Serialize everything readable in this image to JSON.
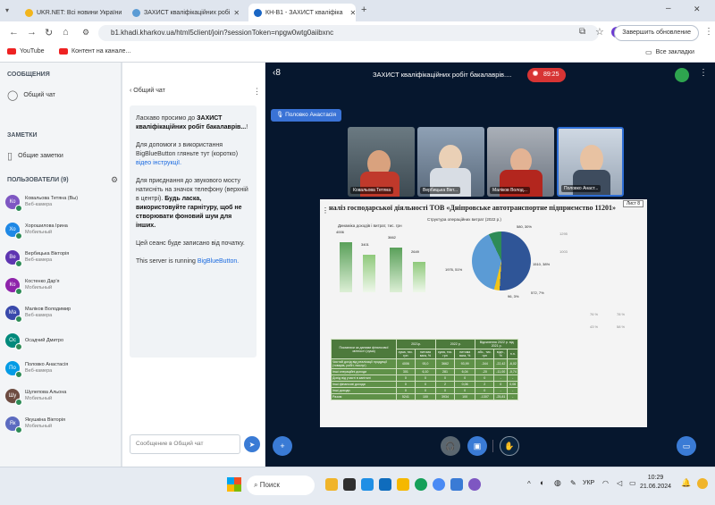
{
  "browser": {
    "tabs": [
      {
        "label": "UKR.NET: Всі новини України",
        "active": false
      },
      {
        "label": "ЗАХИСТ кваліфікаційних робі",
        "active": false
      },
      {
        "label": "КН-В1 - ЗАХИСТ кваліфіка",
        "active": true
      }
    ],
    "new_tab": "+",
    "window_min": "–",
    "window_close": "✕",
    "url": "b1.khadi.kharkov.ua/html5client/join?sessionToken=npgw0wtg0aiibxnc",
    "update_button": "Завершить обновление",
    "bookmarks": [
      {
        "label": "YouTube"
      },
      {
        "label": "Контент на канале..."
      }
    ],
    "all_bookmarks": "Все закладки"
  },
  "sidebar": {
    "messages_heading": "СООБЩЕНИЯ",
    "public_chat": "Общий чат",
    "notes_heading": "ЗАМЕТКИ",
    "shared_notes": "Общие заметки",
    "users_heading": "ПОЛЬЗОВАТЕЛИ (9)",
    "users": [
      {
        "initials": "Ко",
        "name": "Ковальова Тетяна (Вы)",
        "sub": "Веб-камера",
        "color": "#7e57c2"
      },
      {
        "initials": "Хо",
        "name": "Хорошилова Ірина",
        "sub": "Мобильный",
        "color": "#1e88e5"
      },
      {
        "initials": "Ве",
        "name": "Вербицька Вікторія",
        "sub": "Веб-камера",
        "color": "#5e35b1"
      },
      {
        "initials": "Ко",
        "name": "Костенко Дар'я",
        "sub": "Мобильный",
        "color": "#8e24aa"
      },
      {
        "initials": "Ма",
        "name": "Маліков Володимир",
        "sub": "Веб-камера",
        "color": "#3949ab"
      },
      {
        "initials": "Ос",
        "name": "Осадчий Дмитро",
        "sub": "",
        "color": "#00897b"
      },
      {
        "initials": "По",
        "name": "Половко Анастасія",
        "sub": "Веб-камера",
        "color": "#039be5"
      },
      {
        "initials": "Шу",
        "name": "Шулепова Альона",
        "sub": "Мобильный",
        "color": "#6d4c41"
      },
      {
        "initials": "Як",
        "name": "Якушкіна Вікторія",
        "sub": "Мобильный",
        "color": "#5c6bc0"
      }
    ]
  },
  "chat": {
    "back_label": "‹  Общий чат",
    "menu": "⋮",
    "welcome_prefix": "Ласкаво просимо до ",
    "welcome_bold": "ЗАХИСТ кваліфікаційних робіт бакалаврів...",
    "welcome_suffix": "!",
    "help_text": "Для допомоги з використання BigBlueButton гляньте тут (коротко) ",
    "help_link": "відео інструкції.",
    "audio_text": "Для приєднання до звукового мосту натисніть на значок телефону (верхній в центрі). ",
    "audio_bold": "Будь ласка, використовуйте гарнітуру, щоб не створювати фоновий шум для інших.",
    "recorded": "Цей сеанс буде записано від початку.",
    "server_text": "This server is running ",
    "server_link": "BigBlueButton.",
    "input_placeholder": "Сообщение в Общий чат",
    "send_icon": "➤"
  },
  "meeting": {
    "title": "ЗАХИСТ кваліфікаційних робіт бакалаврів....",
    "timer": "89:25",
    "speaker": "Половко Анастасія",
    "cams": [
      {
        "label": "Ковальова Тетяна"
      },
      {
        "label": "Вербицька Вікт..."
      },
      {
        "label": "Маліков Волод..."
      },
      {
        "label": "Половко Анаст..."
      }
    ],
    "slide": {
      "title": "наліз господарської діяльності ТОВ «Дніпровське автотранспортне підприємство 11201»",
      "sheet": "Лист 8",
      "subtitle": "Структура операційних витрат (2022 р.)",
      "chart_title": "Динаміка доходів і витрат, тис. грн",
      "bar_values": [
        "4006",
        "3401",
        "3662",
        "2649"
      ],
      "pie_labels": [
        "580, 30%",
        "1510, 38%",
        "96, 3%",
        "1976, 51%",
        "572, 7%"
      ],
      "right_values": [
        "1295",
        "1003",
        "76 %",
        "78 %",
        "43 %",
        "58 %"
      ],
      "table_head": [
        "Показники за даними фінансової звітності (сума)",
        "2021р.",
        "2022 р.",
        "Відхилення 2022 р. від 2021 р."
      ],
      "table_subhead": [
        "сума, тис. грн",
        "питома вага, %",
        "сума, тис. грн",
        "питома вага, %",
        "абс., тис. грн",
        "відн., %",
        "п.п."
      ],
      "table_rows": [
        [
          "Чистий дохід від реалізації продукції (товарів, робіт, послуг)",
          "4006",
          "93,0",
          "3662",
          "93,99",
          "-344",
          "-22,42",
          "-6,02"
        ],
        [
          "Інші операційні доходи",
          "301",
          "6,10",
          "281",
          "6,04",
          "-20",
          "-11,00",
          "-0,74"
        ],
        [
          "Дохід від участі в капіталі",
          "0",
          "0",
          "0",
          "0",
          "0",
          "-",
          "-"
        ],
        [
          "Інші фінансові доходи",
          "0",
          "0",
          "2",
          "0,06",
          "2",
          "0",
          "0,06"
        ],
        [
          "Інші доходи",
          "0",
          "0",
          "0",
          "0",
          "0",
          "-",
          "-"
        ],
        [
          "Разом",
          "5241",
          "100",
          "3934",
          "100",
          "-1307",
          "-25,81",
          "-"
        ]
      ]
    }
  },
  "taskbar": {
    "search": "Поиск",
    "lang": "УКР",
    "time": "10:29",
    "date": "21.06.2024"
  },
  "colors": {
    "meeting_bg": "#06172e",
    "accent": "#3a7bd5",
    "record": "#d73434",
    "table_green": "#5f9148"
  }
}
